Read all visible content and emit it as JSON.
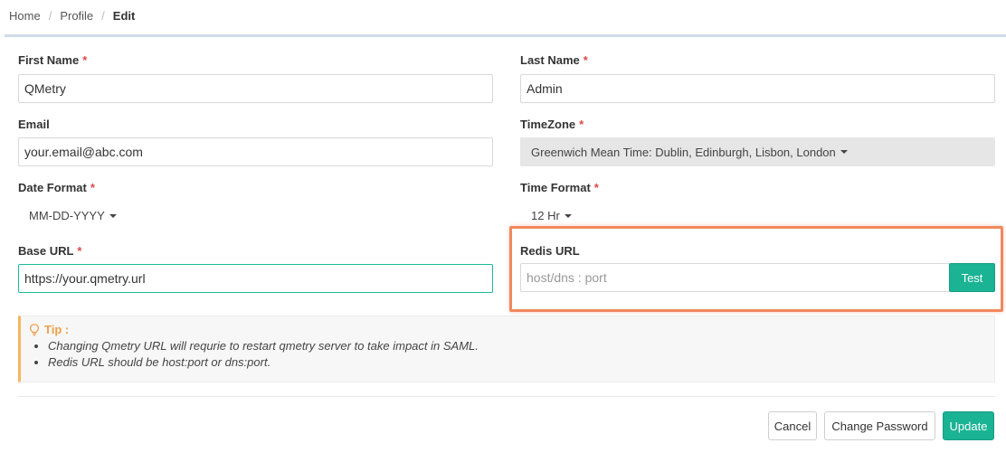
{
  "breadcrumb": {
    "items": [
      "Home",
      "Profile",
      "Edit"
    ],
    "separator": "/"
  },
  "form": {
    "first_name": {
      "label": "First Name",
      "required_mark": "*",
      "value": "QMetry"
    },
    "last_name": {
      "label": "Last Name",
      "required_mark": "*",
      "value": "Admin"
    },
    "email": {
      "label": "Email",
      "value": "your.email@abc.com"
    },
    "timezone": {
      "label": "TimeZone",
      "required_mark": "*",
      "value": "Greenwich Mean Time: Dublin, Edinburgh, Lisbon, London"
    },
    "date_format": {
      "label": "Date Format",
      "required_mark": "*",
      "value": "MM-DD-YYYY"
    },
    "time_format": {
      "label": "Time Format",
      "required_mark": "*",
      "value": "12 Hr"
    },
    "base_url": {
      "label": "Base URL",
      "required_mark": "*",
      "value": "https://your.qmetry.url"
    },
    "redis_url": {
      "label": "Redis URL",
      "placeholder": "host/dns : port",
      "value": "",
      "test_label": "Test"
    }
  },
  "tip": {
    "title": "Tip :",
    "items": [
      "Changing Qmetry URL will requrie to restart qmetry server to take impact in SAML.",
      "Redis URL should be host:port or dns:port."
    ]
  },
  "actions": {
    "cancel_label": "Cancel",
    "change_password_label": "Change Password",
    "update_label": "Update"
  },
  "colors": {
    "accent": "#1ab394",
    "required": "#e04848",
    "highlight": "#f0885e",
    "tip_accent": "#f0a04b"
  }
}
